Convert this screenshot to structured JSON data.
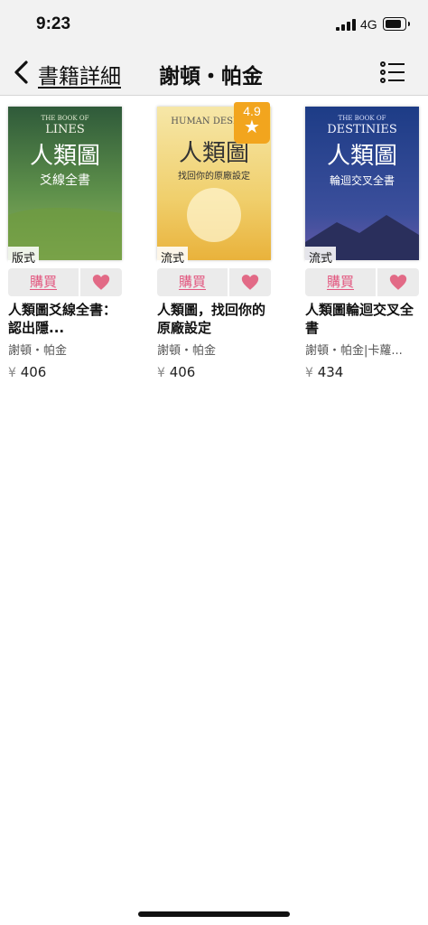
{
  "status": {
    "time": "9:23",
    "network": "4G"
  },
  "nav": {
    "back_label": "書籍詳細",
    "title": "謝頓・帕金"
  },
  "books": [
    {
      "title": "人類圖爻線全書：認出隱...",
      "author": "謝頓・帕金",
      "price": "406",
      "currency": "¥",
      "format": "版式",
      "buy_label": "購買",
      "cover": {
        "top_text": "THE BOOK OF",
        "big_text": "LINES",
        "main_title": "人類圖",
        "sub_title": "爻線全書",
        "colors": [
          "#2f5a3a",
          "#8fb35f"
        ]
      }
    },
    {
      "title": "人類圖，找回你的原廠設定",
      "author": "謝頓・帕金",
      "price": "406",
      "currency": "¥",
      "format": "流式",
      "rating": "4.9",
      "buy_label": "購買",
      "cover": {
        "top_text": "HUMAN DESIGN",
        "main_title": "人類圖",
        "sub_title": "找回你的原廠設定",
        "colors": [
          "#f6e7a8",
          "#e9b23b"
        ]
      }
    },
    {
      "title": "人類圖輪迴交叉全書",
      "author": "謝頓・帕金|卡蘿...",
      "price": "434",
      "currency": "¥",
      "format": "流式",
      "buy_label": "購買",
      "cover": {
        "top_text": "THE BOOK OF",
        "big_text": "DESTINIES",
        "main_title": "人類圖",
        "sub_title": "輪迴交叉全書",
        "colors": [
          "#1d3c86",
          "#6a5aa8"
        ]
      }
    }
  ],
  "colors": {
    "accent": "#e2557e",
    "rating_badge": "#f2a51e",
    "heart": "#e26a86"
  }
}
